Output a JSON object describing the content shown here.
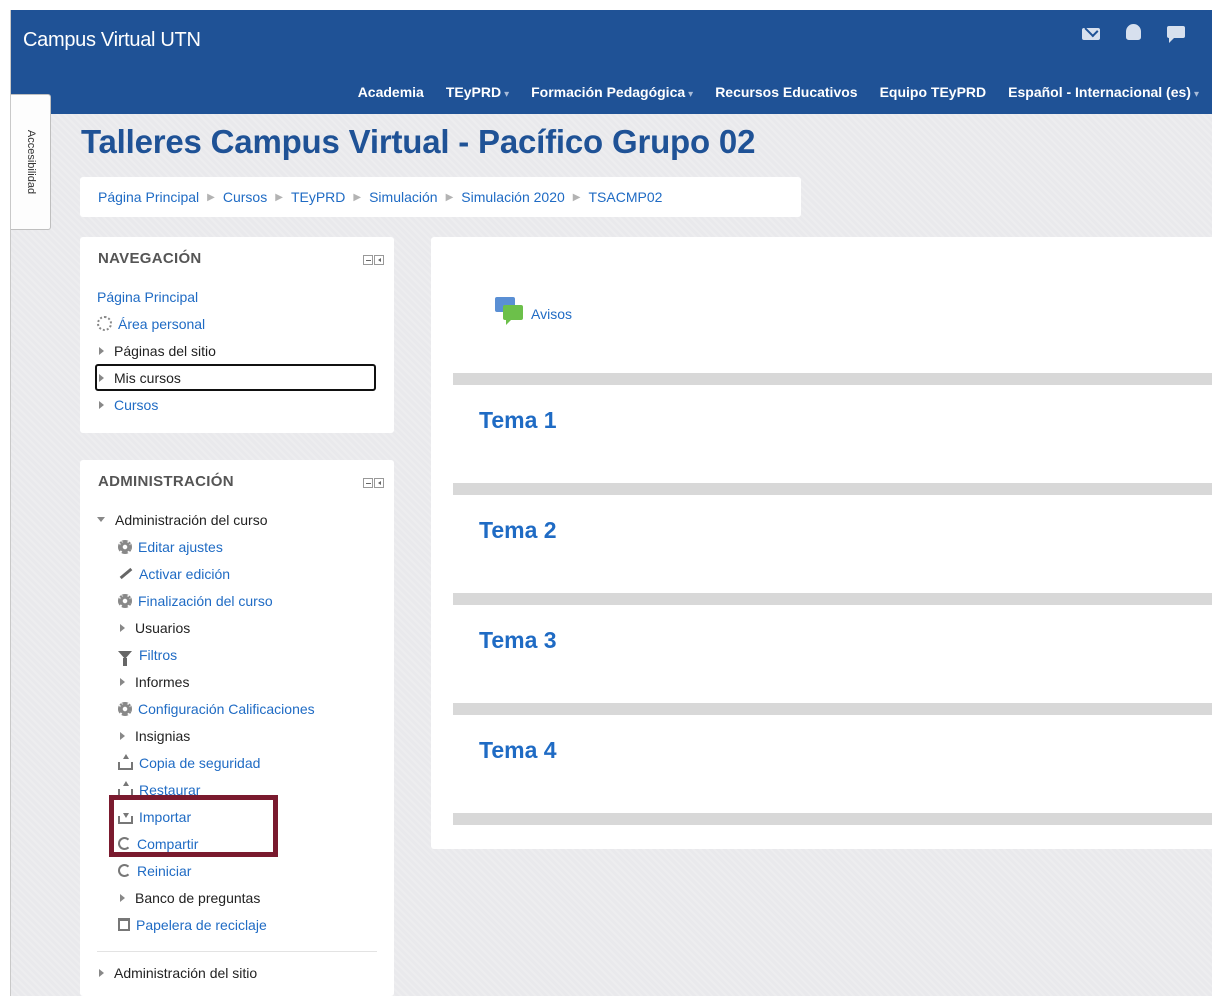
{
  "header": {
    "brand": "Campus Virtual UTN",
    "icons": [
      "mail-icon",
      "bell-icon",
      "chat-icon"
    ],
    "menu": [
      {
        "label": "Academia",
        "caret": false
      },
      {
        "label": "TEyPRD",
        "caret": true
      },
      {
        "label": "Formación Pedagógica",
        "caret": true
      },
      {
        "label": "Recursos Educativos",
        "caret": false
      },
      {
        "label": "Equipo TEyPRD",
        "caret": false
      },
      {
        "label": "Español - Internacional (es)",
        "caret": true
      }
    ]
  },
  "accessibility_tab": "Accesibilidad",
  "page_title": "Talleres Campus Virtual - Pacífico Grupo 02",
  "breadcrumb": [
    "Página Principal",
    "Cursos",
    "TEyPRD",
    "Simulación",
    "Simulación 2020",
    "TSACMP02"
  ],
  "navigation": {
    "title": "NAVEGACIÓN",
    "items": [
      "Página Principal",
      "Área personal",
      "Páginas del sitio",
      "Mis cursos",
      "Cursos"
    ]
  },
  "administration": {
    "title": "ADMINISTRACIÓN",
    "course_admin": "Administración del curso",
    "items": [
      "Editar ajustes",
      "Activar edición",
      "Finalización del curso",
      "Usuarios",
      "Filtros",
      "Informes",
      "Configuración Calificaciones",
      "Insignias",
      "Copia de seguridad",
      "Restaurar",
      "Importar",
      "Compartir",
      "Reiniciar",
      "Banco de preguntas",
      "Papelera de reciclaje"
    ],
    "site_admin": "Administración del sitio"
  },
  "main": {
    "forum_label": "Avisos",
    "topics": [
      "Tema 1",
      "Tema 2",
      "Tema 3",
      "Tema 4"
    ]
  },
  "colors": {
    "header_bg": "#1f5296",
    "link": "#1f6bc4",
    "highlight_border": "#7a1a2e"
  }
}
